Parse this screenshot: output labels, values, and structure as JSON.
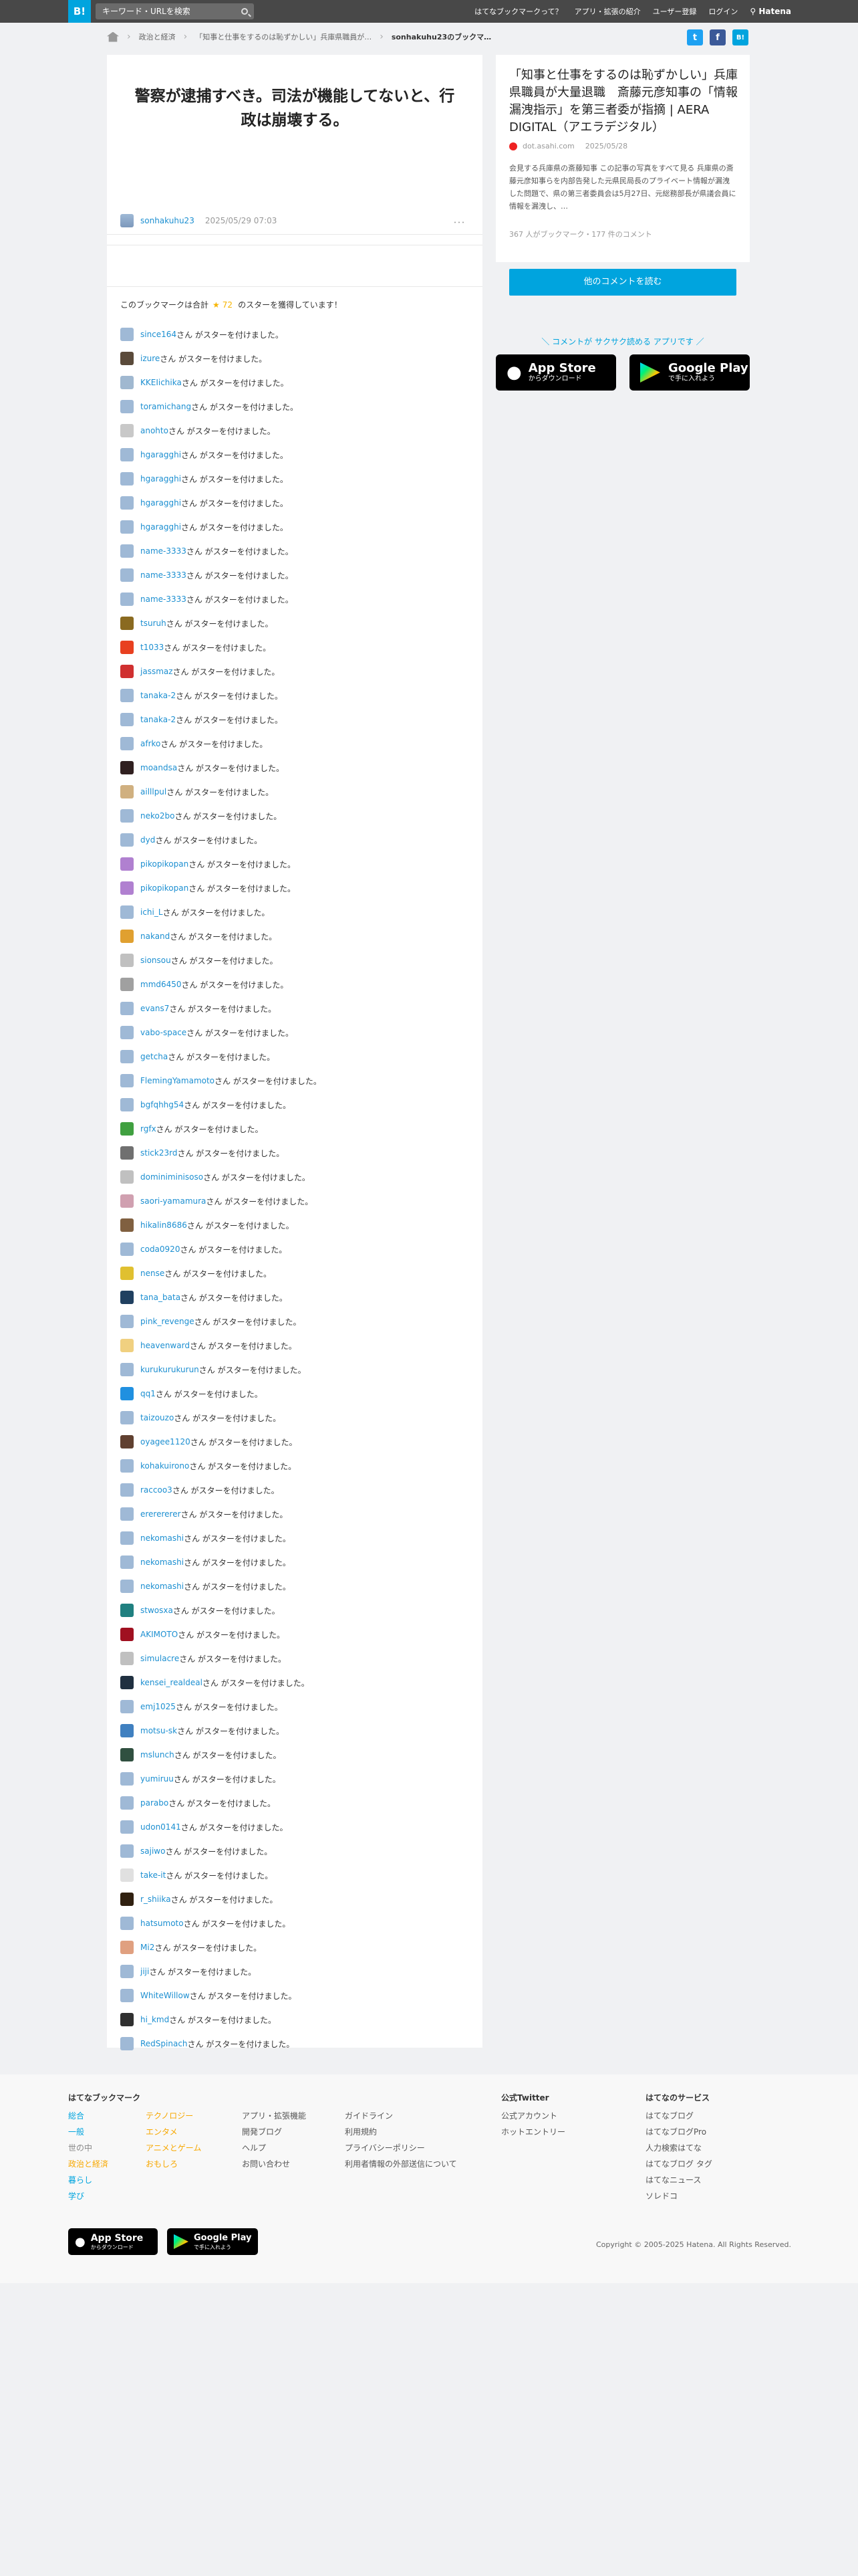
{
  "header": {
    "logo": "B!",
    "search_placeholder": "キーワード・URLを検索",
    "nav": [
      "はてなブックマークって？",
      "アプリ・拡張の紹介",
      "ユーザー登録",
      "ログイン"
    ],
    "hatena": "Hatena"
  },
  "breadcrumb": {
    "items": [
      "政治と経済",
      "「知事と仕事をするのは恥ずかしい」兵庫県職員が…",
      "sonhakuhu23のブックマ…"
    ]
  },
  "share": {
    "twitter": "t",
    "facebook": "f",
    "hatebu": "B!"
  },
  "bookmark": {
    "comment": "警察が逮捕すべき。司法が機能してないと、行政は崩壊する。",
    "user": "sonhakuhu23",
    "date": "2025/05/29 07:03",
    "more": "･･･"
  },
  "summary": {
    "before": "このブックマークは合計",
    "star": "★",
    "count": "72",
    "after": "のスターを獲得しています！"
  },
  "star_suffix": "さん がスターを付けました。",
  "star_users": [
    "since164",
    "izure",
    "KKEIichika",
    "toramichang",
    "anohto",
    "hgaragghi",
    "hgaragghi",
    "hgaragghi",
    "hgaragghi",
    "name-3333",
    "name-3333",
    "name-3333",
    "tsuruh",
    "t1033",
    "jassmaz",
    "tanaka-2",
    "tanaka-2",
    "afrko",
    "moandsa",
    "ailllpul",
    "neko2bo",
    "dyd",
    "pikopikopan",
    "pikopikopan",
    "ichi_L",
    "nakand",
    "sionsou",
    "mmd6450",
    "evans7",
    "vabo-space",
    "getcha",
    "FlemingYamamoto",
    "bgfqhhg54",
    "rgfx",
    "stick23rd",
    "dominiminisoso",
    "saori-yamamura",
    "hikalin8686",
    "coda0920",
    "nense",
    "tana_bata",
    "pink_revenge",
    "heavenward",
    "kurukurukurun",
    "qq1",
    "taizouzo",
    "oyagee1120",
    "kohakuirono",
    "raccoo3",
    "ererererer",
    "nekomashi",
    "nekomashi",
    "nekomashi",
    "stwosxa",
    "AKIMOTO",
    "simulacre",
    "kensei_realdeal",
    "emj1025",
    "motsu-sk",
    "mslunch",
    "yumiruu",
    "parabo",
    "udon0141",
    "sajiwo",
    "take-it",
    "r_shiika",
    "hatsumoto",
    "Mi2",
    "jiji",
    "WhiteWillow",
    "hi_kmd",
    "RedSpinach"
  ],
  "entry": {
    "title": "「知事と仕事をするのは恥ずかしい」兵庫県職員が大量退職　斎藤元彦知事の「情報漏洩指示」を第三者委が指摘 | AERA DIGITAL（アエラデジタル）",
    "site": "dot.asahi.com",
    "date": "2025/05/28",
    "desc": "会見する兵庫県の斎藤知事 この記事の写真をすべて見る 兵庫県の斎藤元彦知事らを内部告発した元県民局長のプライベート情報が漏洩した問題で、県の第三者委員会は5月27日、元総務部長が県議会員に情報を漏洩し、…",
    "counts": "367 人がブックマーク・177 件のコメント",
    "button": "他のコメントを読む"
  },
  "promo": "＼ コメントが サクサク読める アプリです ／",
  "appstore": {
    "big": "App Store",
    "small": "からダウンロード"
  },
  "googleplay": {
    "big": "Google Play",
    "small": "で手に入れよう"
  },
  "footer": {
    "title": "はてなブックマーク",
    "cats1": [
      "総合",
      "一般",
      "世の中",
      "政治と経済",
      "暮らし",
      "学び"
    ],
    "cats2": [
      "テクノロジー",
      "エンタメ",
      "アニメとゲーム",
      "おもしろ"
    ],
    "col3": [
      "アプリ・拡張機能",
      "開発ブログ",
      "ヘルプ",
      "お問い合わせ"
    ],
    "col4": [
      "ガイドライン",
      "利用規約",
      "プライバシーポリシー",
      "利用者情報の外部送信について"
    ],
    "twitter_title": "公式Twitter",
    "twitter": [
      "公式アカウント",
      "ホットエントリー"
    ],
    "services_title": "はてなのサービス",
    "services": [
      "はてなブログ",
      "はてなブログPro",
      "人力検索はてな",
      "はてなブログ タグ",
      "はてなニュース",
      "ソレドコ"
    ],
    "copyright": "Copyright © 2005-2025 Hatena. All Rights Reserved."
  },
  "colors": {
    "accent": "#00a4de",
    "header": "#484848",
    "star": "#f7b500",
    "link": "#1c8fd1"
  }
}
